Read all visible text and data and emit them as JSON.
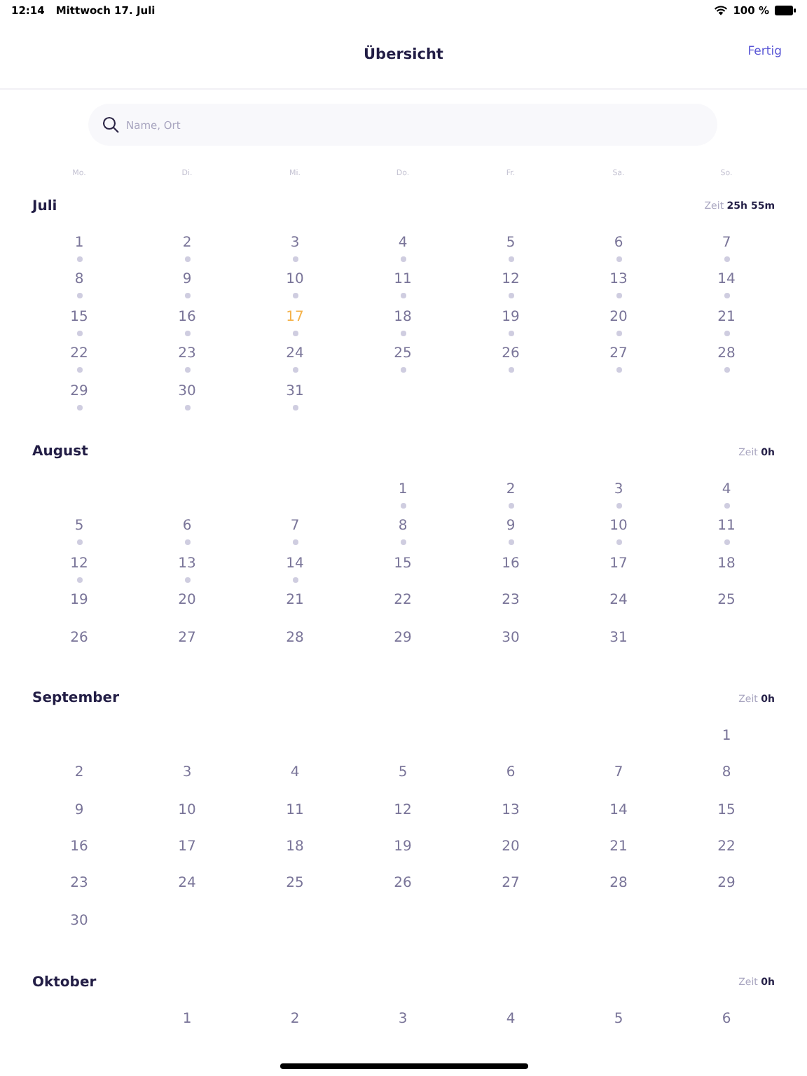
{
  "status_bar": {
    "time": "12:14",
    "date": "Mittwoch 17. Juli",
    "battery": "100 %"
  },
  "nav": {
    "title": "Übersicht",
    "done": "Fertig"
  },
  "search": {
    "placeholder": "Name, Ort"
  },
  "weekdays": [
    "Mo.",
    "Di.",
    "Mi.",
    "Do.",
    "Fr.",
    "Sa.",
    "So."
  ],
  "months": [
    {
      "name": "Juli",
      "total": "Zeit **25h 55m**",
      "weeks": [
        [
          {
            "d": "1",
            "dot": true,
            "today": false
          },
          {
            "d": "2",
            "dot": true,
            "today": false
          },
          {
            "d": "3",
            "dot": true,
            "today": false
          },
          {
            "d": "4",
            "dot": true,
            "today": false
          },
          {
            "d": "5",
            "dot": true,
            "today": false
          },
          {
            "d": "6",
            "dot": true,
            "today": false
          },
          {
            "d": "7",
            "dot": true,
            "today": false
          }
        ],
        [
          {
            "d": "8",
            "dot": true,
            "today": false
          },
          {
            "d": "9",
            "dot": true,
            "today": false
          },
          {
            "d": "10",
            "dot": true,
            "today": false
          },
          {
            "d": "11",
            "dot": true,
            "today": false
          },
          {
            "d": "12",
            "dot": true,
            "today": false
          },
          {
            "d": "13",
            "dot": true,
            "today": false
          },
          {
            "d": "14",
            "dot": true,
            "today": false
          }
        ],
        [
          {
            "d": "15",
            "dot": true,
            "today": false
          },
          {
            "d": "16",
            "dot": true,
            "today": false
          },
          {
            "d": "17",
            "dot": true,
            "today": true
          },
          {
            "d": "18",
            "dot": true,
            "today": false
          },
          {
            "d": "19",
            "dot": true,
            "today": false
          },
          {
            "d": "20",
            "dot": true,
            "today": false
          },
          {
            "d": "21",
            "dot": true,
            "today": false
          }
        ],
        [
          {
            "d": "22",
            "dot": true,
            "today": false
          },
          {
            "d": "23",
            "dot": true,
            "today": false
          },
          {
            "d": "24",
            "dot": true,
            "today": false
          },
          {
            "d": "25",
            "dot": true,
            "today": false
          },
          {
            "d": "26",
            "dot": true,
            "today": false
          },
          {
            "d": "27",
            "dot": true,
            "today": false
          },
          {
            "d": "28",
            "dot": true,
            "today": false
          }
        ],
        [
          {
            "d": "29",
            "dot": true,
            "today": false
          },
          {
            "d": "30",
            "dot": true,
            "today": false
          },
          {
            "d": "31",
            "dot": true,
            "today": false
          }
        ]
      ]
    },
    {
      "name": "August",
      "total": "Zeit **0h**",
      "weeks": [
        [
          {
            "d": "1",
            "dot": true,
            "today": false
          },
          {
            "d": "2",
            "dot": true,
            "today": false
          },
          {
            "d": "3",
            "dot": true,
            "today": false
          },
          {
            "d": "4",
            "dot": true,
            "today": false
          }
        ],
        [
          {
            "d": "5",
            "dot": true,
            "today": false
          },
          {
            "d": "6",
            "dot": true,
            "today": false
          },
          {
            "d": "7",
            "dot": true,
            "today": false
          },
          {
            "d": "8",
            "dot": true,
            "today": false
          },
          {
            "d": "9",
            "dot": true,
            "today": false
          },
          {
            "d": "10",
            "dot": true,
            "today": false
          },
          {
            "d": "11",
            "dot": true,
            "today": false
          }
        ],
        [
          {
            "d": "12",
            "dot": true,
            "today": false
          },
          {
            "d": "13",
            "dot": true,
            "today": false
          },
          {
            "d": "14",
            "dot": true,
            "today": false
          },
          {
            "d": "15",
            "dot": false,
            "today": false
          },
          {
            "d": "16",
            "dot": false,
            "today": false
          },
          {
            "d": "17",
            "dot": false,
            "today": false
          },
          {
            "d": "18",
            "dot": false,
            "today": false
          }
        ],
        [
          {
            "d": "19",
            "dot": false,
            "today": false
          },
          {
            "d": "20",
            "dot": false,
            "today": false
          },
          {
            "d": "21",
            "dot": false,
            "today": false
          },
          {
            "d": "22",
            "dot": false,
            "today": false
          },
          {
            "d": "23",
            "dot": false,
            "today": false
          },
          {
            "d": "24",
            "dot": false,
            "today": false
          },
          {
            "d": "25",
            "dot": false,
            "today": false
          }
        ],
        [
          {
            "d": "26",
            "dot": false,
            "today": false
          },
          {
            "d": "27",
            "dot": false,
            "today": false
          },
          {
            "d": "28",
            "dot": false,
            "today": false
          },
          {
            "d": "29",
            "dot": false,
            "today": false
          },
          {
            "d": "30",
            "dot": false,
            "today": false
          },
          {
            "d": "31",
            "dot": false,
            "today": false
          }
        ]
      ]
    },
    {
      "name": "September",
      "total": "Zeit **0h**",
      "weeks": [
        [
          {
            "d": "1",
            "dot": false,
            "today": false
          }
        ],
        [
          {
            "d": "2",
            "dot": false,
            "today": false
          },
          {
            "d": "3",
            "dot": false,
            "today": false
          },
          {
            "d": "4",
            "dot": false,
            "today": false
          },
          {
            "d": "5",
            "dot": false,
            "today": false
          },
          {
            "d": "6",
            "dot": false,
            "today": false
          },
          {
            "d": "7",
            "dot": false,
            "today": false
          },
          {
            "d": "8",
            "dot": false,
            "today": false
          }
        ],
        [
          {
            "d": "9",
            "dot": false,
            "today": false
          },
          {
            "d": "10",
            "dot": false,
            "today": false
          },
          {
            "d": "11",
            "dot": false,
            "today": false
          },
          {
            "d": "12",
            "dot": false,
            "today": false
          },
          {
            "d": "13",
            "dot": false,
            "today": false
          },
          {
            "d": "14",
            "dot": false,
            "today": false
          },
          {
            "d": "15",
            "dot": false,
            "today": false
          }
        ],
        [
          {
            "d": "16",
            "dot": false,
            "today": false
          },
          {
            "d": "17",
            "dot": false,
            "today": false
          },
          {
            "d": "18",
            "dot": false,
            "today": false
          },
          {
            "d": "19",
            "dot": false,
            "today": false
          },
          {
            "d": "20",
            "dot": false,
            "today": false
          },
          {
            "d": "21",
            "dot": false,
            "today": false
          },
          {
            "d": "22",
            "dot": false,
            "today": false
          }
        ],
        [
          {
            "d": "23",
            "dot": false,
            "today": false
          },
          {
            "d": "24",
            "dot": false,
            "today": false
          },
          {
            "d": "25",
            "dot": false,
            "today": false
          },
          {
            "d": "26",
            "dot": false,
            "today": false
          },
          {
            "d": "27",
            "dot": false,
            "today": false
          },
          {
            "d": "28",
            "dot": false,
            "today": false
          },
          {
            "d": "29",
            "dot": false,
            "today": false
          }
        ],
        [
          {
            "d": "30",
            "dot": false,
            "today": false
          }
        ]
      ]
    },
    {
      "name": "Oktober",
      "total": "Zeit **0h**",
      "weeks": [
        [
          {
            "d": "1",
            "dot": false,
            "today": false
          },
          {
            "d": "2",
            "dot": false,
            "today": false
          },
          {
            "d": "3",
            "dot": false,
            "today": false
          },
          {
            "d": "4",
            "dot": false,
            "today": false
          },
          {
            "d": "5",
            "dot": false,
            "today": false
          },
          {
            "d": "6",
            "dot": false,
            "today": false
          }
        ]
      ]
    }
  ]
}
